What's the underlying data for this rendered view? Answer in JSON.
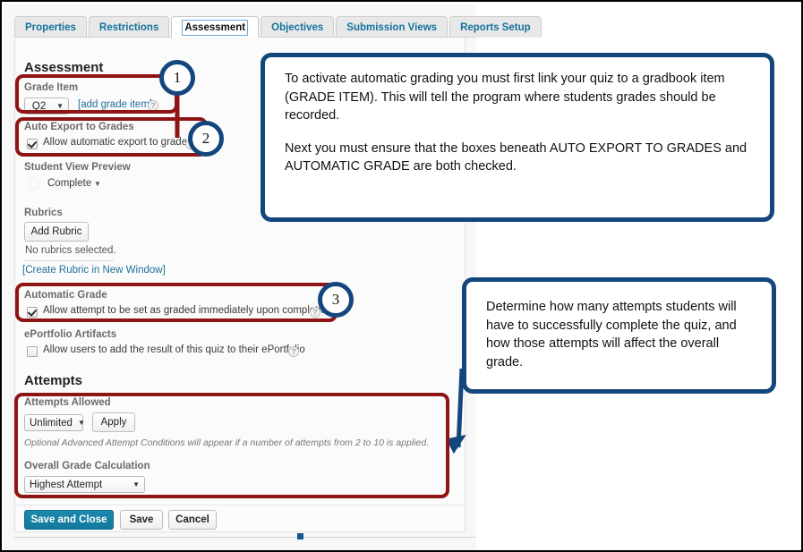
{
  "tabs": [
    {
      "label": "Properties",
      "active": false
    },
    {
      "label": "Restrictions",
      "active": false
    },
    {
      "label": "Assessment",
      "active": true
    },
    {
      "label": "Objectives",
      "active": false
    },
    {
      "label": "Submission Views",
      "active": false
    },
    {
      "label": "Reports Setup",
      "active": false
    }
  ],
  "assessment": {
    "section_title": "Assessment",
    "grade_item": {
      "label": "Grade Item",
      "selected": "Q2",
      "add_link": "[add grade item]",
      "help_icon": "help-icon"
    },
    "auto_export": {
      "label": "Auto Export to Grades",
      "checkbox_label": "Allow automatic export to grades",
      "checked": true,
      "help_icon": "help-icon"
    },
    "student_view_preview": {
      "label": "Student View Preview",
      "selected": "Complete"
    },
    "rubrics": {
      "label": "Rubrics",
      "add_button": "Add Rubric",
      "empty_text": "No rubrics selected.",
      "create_link": "[Create Rubric in New Window]"
    },
    "automatic_grade": {
      "label": "Automatic Grade",
      "checkbox_label": "Allow attempt to be set as graded immediately upon completion",
      "checked": true,
      "help_icon": "help-icon"
    },
    "eportfolio": {
      "label": "ePortfolio Artifacts",
      "checkbox_label": "Allow users to add the result of this quiz to their ePortfolio",
      "checked": false,
      "help_icon": "help-icon"
    }
  },
  "attempts": {
    "section_title": "Attempts",
    "attempts_allowed": {
      "label": "Attempts Allowed",
      "selected": "Unlimited",
      "apply_button": "Apply",
      "note": "Optional Advanced Attempt Conditions will appear if a number of attempts from 2 to 10 is applied."
    },
    "overall_grade_calculation": {
      "label": "Overall Grade Calculation",
      "selected": "Highest Attempt"
    }
  },
  "footer": {
    "save_and_close": "Save and Close",
    "save": "Save",
    "cancel": "Cancel"
  },
  "annotations": {
    "badges": [
      {
        "number": "1"
      },
      {
        "number": "2"
      },
      {
        "number": "3"
      }
    ],
    "callout_top": {
      "paragraph_1": "To activate automatic grading you must first link your quiz to a gradbook item (GRADE ITEM).  This will tell the program where students grades should be recorded.",
      "paragraph_2": "Next you must ensure that the boxes beneath AUTO EXPORT TO GRADES and AUTOMATIC GRADE are both checked."
    },
    "callout_bottom": {
      "paragraph_1": "Determine how many attempts students will have to successfully complete the quiz, and how those attempts will affect the overall grade."
    }
  },
  "colors": {
    "highlight_red": "#8f1515",
    "callout_blue": "#14467e",
    "primary_button": "#127a9c",
    "tab_link": "#15729e"
  }
}
